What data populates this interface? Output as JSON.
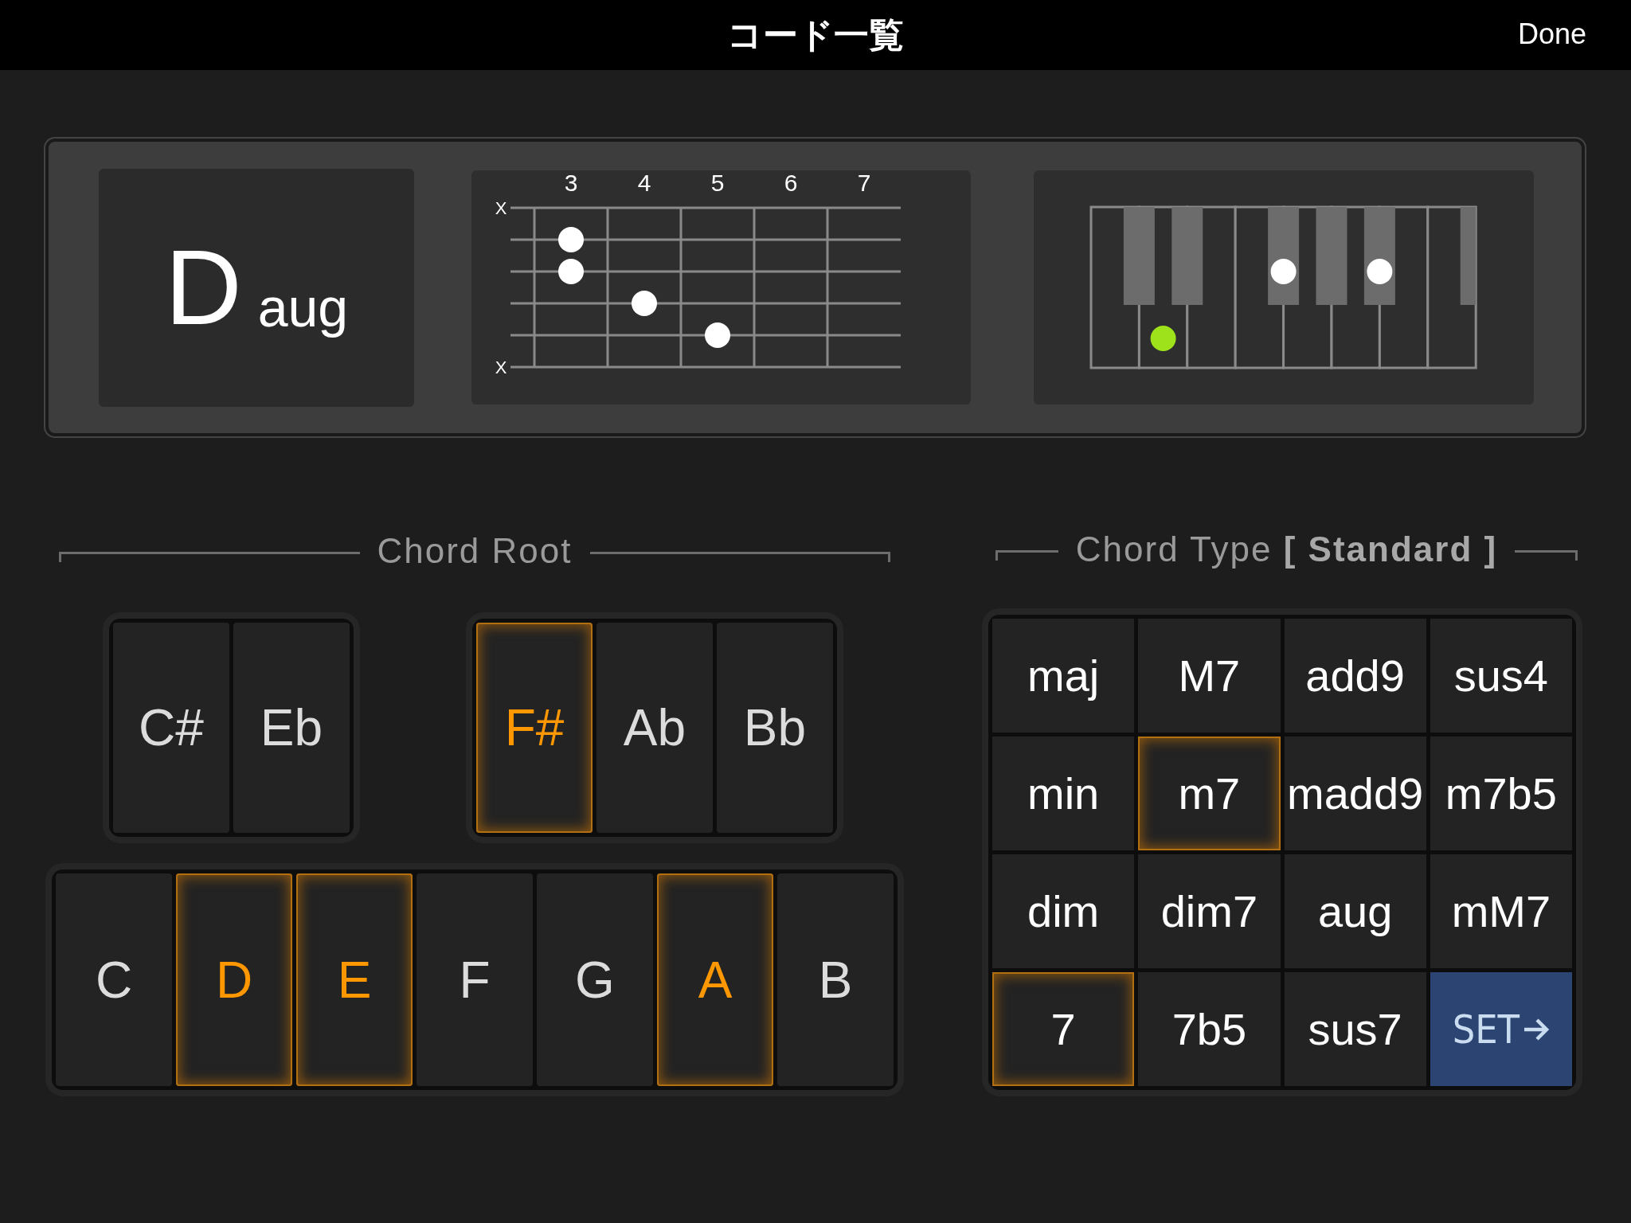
{
  "nav_bar": {
    "title": "コード一覧",
    "done_button": "Done"
  },
  "chord_display": {
    "root": "D",
    "type": "aug"
  },
  "fretboard": {
    "fret_numbers": [
      "3",
      "4",
      "5",
      "6",
      "7"
    ],
    "strings": [
      {
        "mark": "X",
        "frets": [
          false,
          false,
          false,
          false,
          false
        ]
      },
      {
        "frets": [
          true,
          false,
          false,
          false,
          false
        ]
      },
      {
        "frets": [
          true,
          false,
          false,
          false,
          false
        ]
      },
      {
        "frets": [
          false,
          true,
          false,
          false,
          false
        ]
      },
      {
        "frets": [
          false,
          false,
          true,
          false,
          false
        ]
      },
      {
        "mark": "X",
        "frets": [
          false,
          false,
          false,
          false,
          false
        ]
      }
    ]
  },
  "piano": {
    "white_keys": [
      {
        "pressed": false
      },
      {
        "pressed": true,
        "color": "#9de21a"
      },
      {
        "pressed": false
      },
      {
        "pressed": false
      },
      {
        "pressed": false
      },
      {
        "pressed": false
      },
      {
        "pressed": false
      },
      {
        "pressed": false
      }
    ],
    "black_keys": [
      {
        "pressed": false
      },
      {
        "pressed": false
      },
      {
        "pressed": true,
        "color": "#ffffff"
      },
      {
        "pressed": false
      },
      {
        "pressed": true,
        "color": "#ffffff"
      },
      {
        "pressed": false
      }
    ]
  },
  "chord_root": {
    "heading": "Chord Root",
    "sharp_groups": [
      [
        {
          "label": "C#",
          "highlighted": false
        },
        {
          "label": "Eb",
          "highlighted": false
        }
      ],
      [
        {
          "label": "F#",
          "highlighted": true
        },
        {
          "label": "Ab",
          "highlighted": false
        },
        {
          "label": "Bb",
          "highlighted": false
        }
      ]
    ],
    "natural_keys": [
      {
        "label": "C",
        "highlighted": false
      },
      {
        "label": "D",
        "highlighted": true
      },
      {
        "label": "E",
        "highlighted": true
      },
      {
        "label": "F",
        "highlighted": false
      },
      {
        "label": "G",
        "highlighted": false
      },
      {
        "label": "A",
        "highlighted": true
      },
      {
        "label": "B",
        "highlighted": false
      }
    ]
  },
  "chord_type": {
    "heading": "Chord Type **[ Standard ]**",
    "buttons": [
      {
        "kind": "type",
        "label": "maj",
        "highlighted": false
      },
      {
        "kind": "type",
        "label": "M7",
        "highlighted": false
      },
      {
        "kind": "type",
        "label": "add9",
        "highlighted": false
      },
      {
        "kind": "type",
        "label": "sus4",
        "highlighted": false
      },
      {
        "kind": "type",
        "label": "min",
        "highlighted": false
      },
      {
        "kind": "type",
        "label": "m7",
        "highlighted": true
      },
      {
        "kind": "type",
        "label": "madd9",
        "highlighted": false
      },
      {
        "kind": "type",
        "label": "m7b5",
        "highlighted": false
      },
      {
        "kind": "type",
        "label": "dim",
        "highlighted": false
      },
      {
        "kind": "type",
        "label": "dim7",
        "highlighted": false
      },
      {
        "kind": "type",
        "label": "aug",
        "highlighted": false
      },
      {
        "kind": "type",
        "label": "mM7",
        "highlighted": false
      },
      {
        "kind": "type",
        "label": "7",
        "highlighted": true
      },
      {
        "kind": "type",
        "label": "7b5",
        "highlighted": false
      },
      {
        "kind": "type",
        "label": "sus7",
        "highlighted": false
      },
      {
        "kind": "set",
        "label": "SET"
      }
    ]
  }
}
